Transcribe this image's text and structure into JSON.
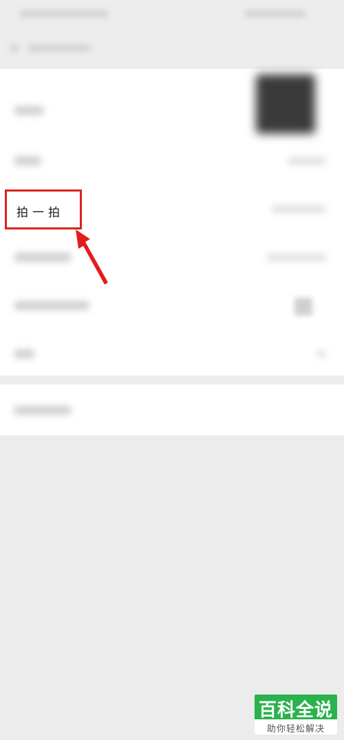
{
  "profile_menu": {
    "highlighted_item_label": "拍一拍"
  },
  "annotation": {
    "highlight_color": "#d9241b"
  },
  "watermark": {
    "title": "百科全说",
    "subtitle": "助你轻松解决",
    "brand_color": "#2bb24c"
  }
}
